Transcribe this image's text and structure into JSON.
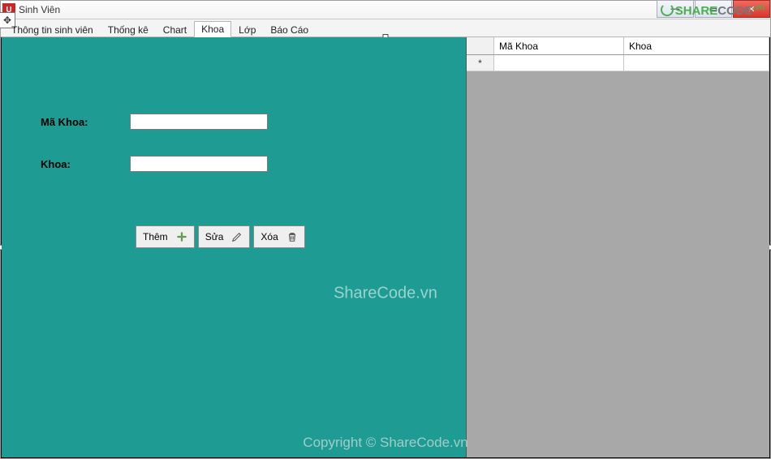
{
  "window": {
    "title": "Sinh Viên",
    "app_icon_letter": "U"
  },
  "tabs": [
    {
      "label": "Thông tin sinh viên",
      "active": false
    },
    {
      "label": "Thống kê",
      "active": false
    },
    {
      "label": "Chart",
      "active": false
    },
    {
      "label": "Khoa",
      "active": true
    },
    {
      "label": "Lớp",
      "active": false
    },
    {
      "label": "Báo Cáo",
      "active": false
    }
  ],
  "form": {
    "fields": {
      "ma_khoa": {
        "label": "Mã Khoa:",
        "value": ""
      },
      "khoa": {
        "label": "Khoa:",
        "value": ""
      }
    },
    "buttons": {
      "add": "Thêm",
      "edit": "Sửa",
      "delete": "Xóa"
    }
  },
  "grid": {
    "columns": [
      "Mã Khoa",
      "Khoa"
    ],
    "new_row_marker": "*",
    "rows": []
  },
  "watermarks": {
    "center": "ShareCode.vn",
    "bottom": "Copyright © ShareCode.vn",
    "logo_text_1": "SHARE",
    "logo_text_2": "CODE",
    "logo_tld": ".vn"
  },
  "win_controls": {
    "minimize": "—",
    "maximize": "▭",
    "close": "✕"
  }
}
